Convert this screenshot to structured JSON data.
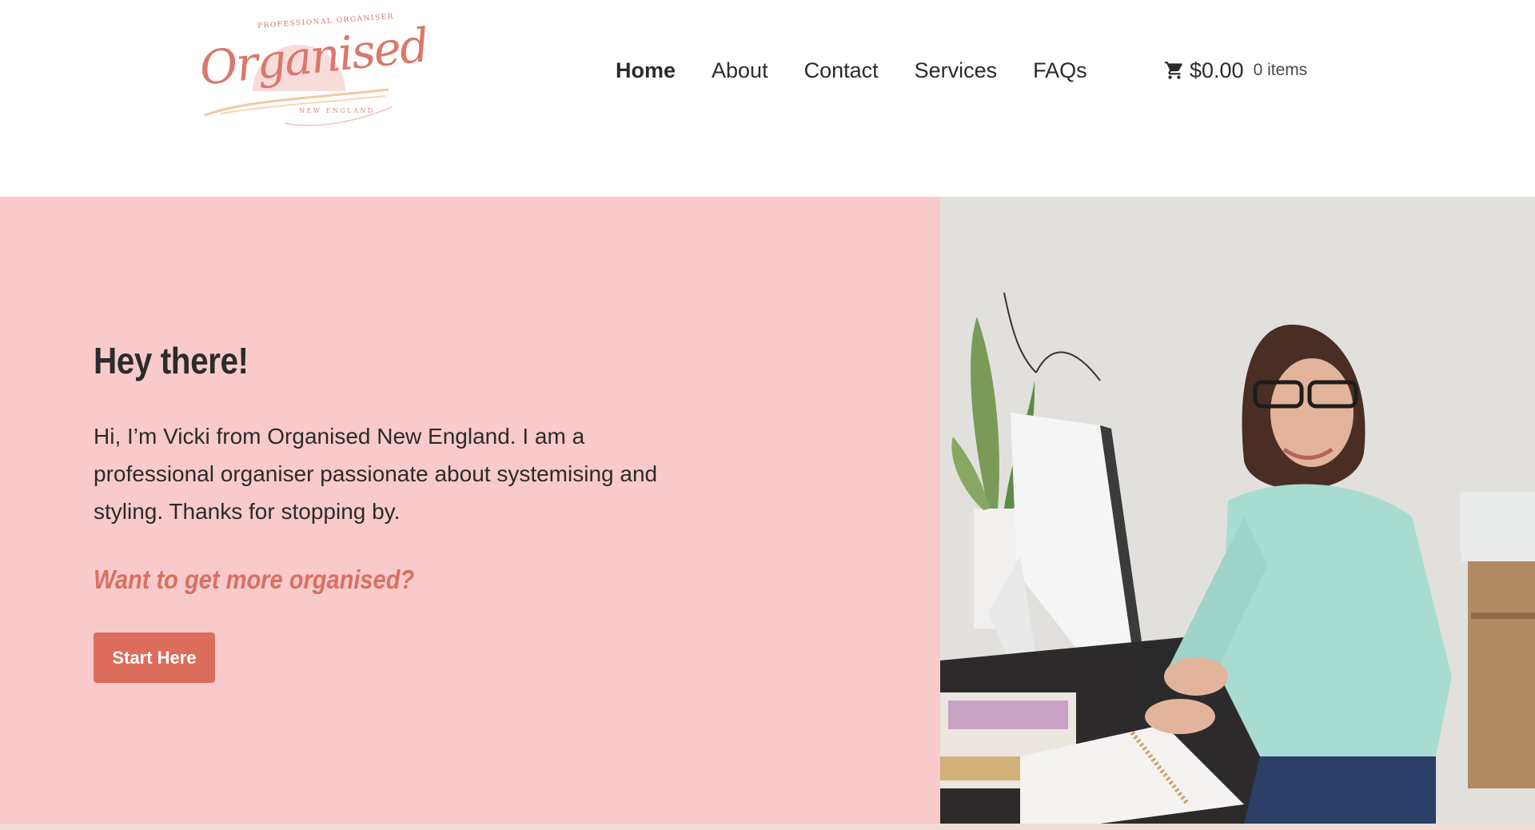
{
  "logo": {
    "script": "Organised",
    "top_text": "PROFESSIONAL ORGANISER",
    "bottom_text": "NEW ENGLAND"
  },
  "nav": {
    "items": [
      {
        "label": "Home",
        "active": true
      },
      {
        "label": "About"
      },
      {
        "label": "Contact"
      },
      {
        "label": "Services"
      },
      {
        "label": "FAQs"
      }
    ]
  },
  "cart": {
    "icon": "cart-icon",
    "total": "$0.00",
    "count": "0 items"
  },
  "hero": {
    "title": "Hey there!",
    "body": "Hi, I’m Vicki from Organised New England. I am a professional organiser passionate about systemising and styling. Thanks for stopping by.",
    "cta_text": "Want to get more organised?",
    "button_label": "Start Here"
  },
  "colors": {
    "hero_bg": "#f8cacc",
    "accent": "#dc6d5b",
    "text": "#2b2b2b"
  }
}
